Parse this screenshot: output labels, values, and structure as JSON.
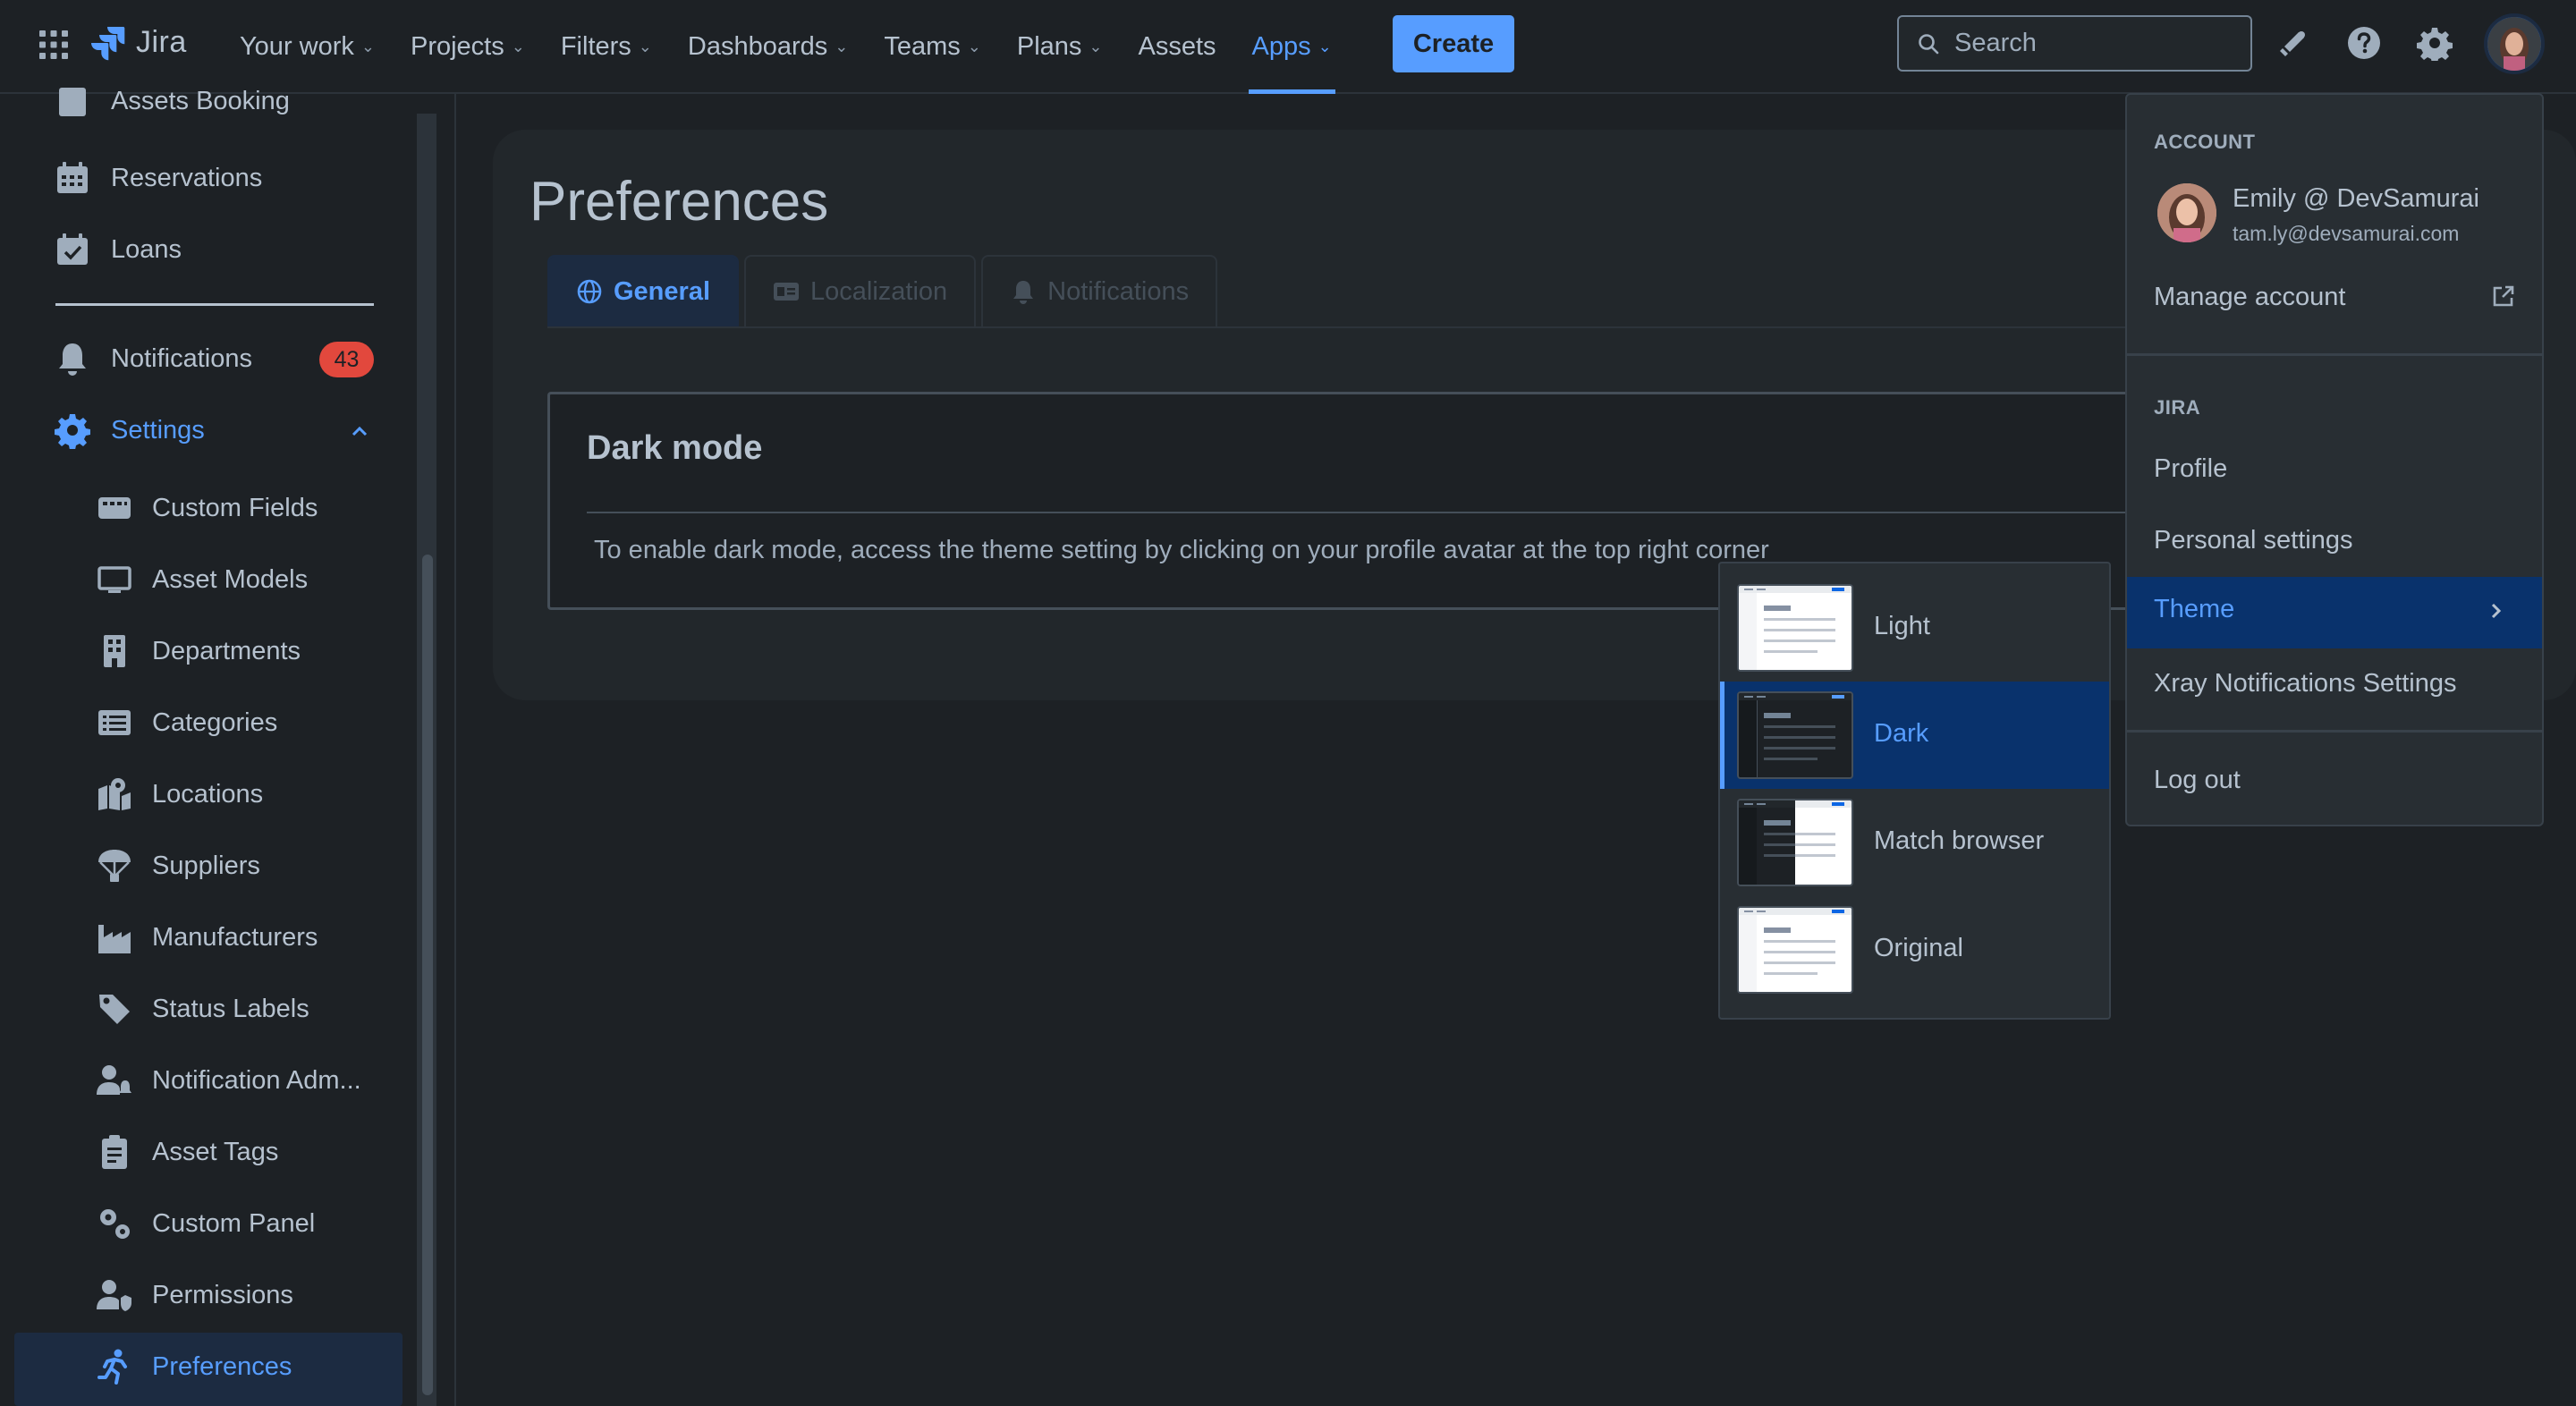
{
  "topnav": {
    "logo": "Jira",
    "items": [
      {
        "label": "Your work",
        "chevron": true
      },
      {
        "label": "Projects",
        "chevron": true
      },
      {
        "label": "Filters",
        "chevron": true
      },
      {
        "label": "Dashboards",
        "chevron": true
      },
      {
        "label": "Teams",
        "chevron": true
      },
      {
        "label": "Plans",
        "chevron": true
      },
      {
        "label": "Assets",
        "chevron": false
      },
      {
        "label": "Apps",
        "chevron": true,
        "active": true
      }
    ],
    "create_label": "Create",
    "search_placeholder": "Search"
  },
  "sidebar": {
    "top_items": [
      {
        "label": "Assets Booking",
        "icon": "clipboard-icon"
      },
      {
        "label": "Reservations",
        "icon": "calendar-icon"
      },
      {
        "label": "Loans",
        "icon": "calendar-check-icon"
      }
    ],
    "notifications": {
      "label": "Notifications",
      "icon": "bell-icon",
      "badge": "43"
    },
    "settings": {
      "label": "Settings",
      "icon": "gear-icon"
    },
    "sub_items": [
      {
        "label": "Custom Fields",
        "icon": "keyboard-icon"
      },
      {
        "label": "Asset Models",
        "icon": "monitor-icon"
      },
      {
        "label": "Departments",
        "icon": "building-icon"
      },
      {
        "label": "Categories",
        "icon": "list-icon"
      },
      {
        "label": "Locations",
        "icon": "map-pin-icon"
      },
      {
        "label": "Suppliers",
        "icon": "parachute-icon"
      },
      {
        "label": "Manufacturers",
        "icon": "factory-icon"
      },
      {
        "label": "Status Labels",
        "icon": "tag-icon"
      },
      {
        "label": "Notification Adm...",
        "icon": "user-bell-icon"
      },
      {
        "label": "Asset Tags",
        "icon": "clipboard-tag-icon"
      },
      {
        "label": "Custom Panel",
        "icon": "cogs-icon"
      },
      {
        "label": "Permissions",
        "icon": "user-shield-icon"
      },
      {
        "label": "Preferences",
        "icon": "running-person-icon",
        "active": true
      }
    ]
  },
  "main": {
    "title": "Preferences",
    "tabs": [
      {
        "label": "General",
        "icon": "globe-icon",
        "active": true
      },
      {
        "label": "Localization",
        "icon": "id-card-icon"
      },
      {
        "label": "Notifications",
        "icon": "bell-icon"
      }
    ],
    "section": {
      "title": "Dark mode",
      "description": "To enable dark mode, access the theme setting by clicking on your profile avatar at the top right corner"
    }
  },
  "account_menu": {
    "account_heading": "ACCOUNT",
    "name": "Emily @ DevSamurai",
    "email": "tam.ly@devsamurai.com",
    "manage_account": "Manage account",
    "jira_heading": "JIRA",
    "profile": "Profile",
    "personal_settings": "Personal settings",
    "theme": "Theme",
    "xray": "Xray Notifications Settings",
    "logout": "Log out"
  },
  "theme_menu": {
    "options": [
      {
        "label": "Light",
        "selected": false
      },
      {
        "label": "Dark",
        "selected": true
      },
      {
        "label": "Match browser",
        "selected": false
      },
      {
        "label": "Original",
        "selected": false
      }
    ]
  },
  "colors": {
    "background": "#1d2125",
    "accent": "#579dff",
    "selected_bg": "#09326c",
    "badge": "#e2483d"
  }
}
